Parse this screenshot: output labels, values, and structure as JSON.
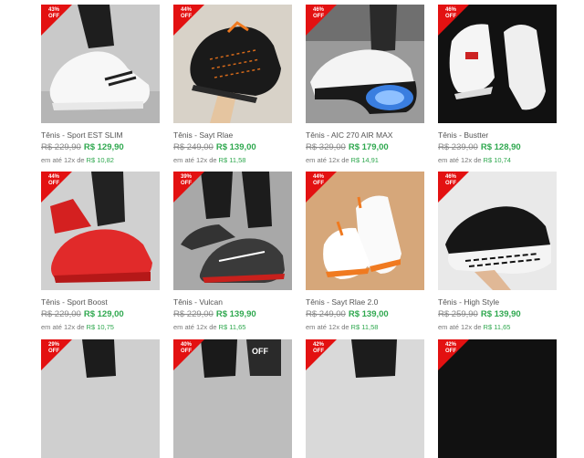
{
  "colors": {
    "badge": "#e31111",
    "price_green": "#2fa84f"
  },
  "products": [
    {
      "name": "Tênis - Sport EST SLIM",
      "discount": "43%",
      "off": "OFF",
      "old_price": "R$ 229,90",
      "new_price": "R$ 129,90",
      "installment": "em até 12x de",
      "installment_value": "R$ 10,82",
      "shoe_color": "white"
    },
    {
      "name": "Tênis - Sayt Rlae",
      "discount": "44%",
      "off": "OFF",
      "old_price": "R$ 249,00",
      "new_price": "R$ 139,00",
      "installment": "em até 12x de",
      "installment_value": "R$ 11,58",
      "shoe_color": "black-orange"
    },
    {
      "name": "Tênis - AIC 270 AIR MAX",
      "discount": "46%",
      "off": "OFF",
      "old_price": "R$ 329,00",
      "new_price": "R$ 179,00",
      "installment": "em até 12x de",
      "installment_value": "R$ 14,91",
      "shoe_color": "white-blue"
    },
    {
      "name": "Tênis - Bustter",
      "discount": "46%",
      "off": "OFF",
      "old_price": "R$ 239,00",
      "new_price": "R$ 128,90",
      "installment": "em até 12x de",
      "installment_value": "R$ 10,74",
      "shoe_color": "white"
    },
    {
      "name": "Tênis - Sport Boost",
      "discount": "44%",
      "off": "OFF",
      "old_price": "R$ 229,00",
      "new_price": "R$ 129,00",
      "installment": "em até 12x de",
      "installment_value": "R$ 10,75",
      "shoe_color": "red"
    },
    {
      "name": "Tênis - Vulcan",
      "discount": "39%",
      "off": "OFF",
      "old_price": "R$ 229,00",
      "new_price": "R$ 139,90",
      "installment": "em até 12x de",
      "installment_value": "R$ 11,65",
      "shoe_color": "gray-red"
    },
    {
      "name": "Tênis - Sayt Rlae 2.0",
      "discount": "44%",
      "off": "OFF",
      "old_price": "R$ 249,00",
      "new_price": "R$ 139,00",
      "installment": "em até 12x de",
      "installment_value": "R$ 11,58",
      "shoe_color": "white-orange"
    },
    {
      "name": "Tênis - High Style",
      "discount": "46%",
      "off": "OFF",
      "old_price": "R$ 259,90",
      "new_price": "R$ 139,90",
      "installment": "em até 12x de",
      "installment_value": "R$ 11,65",
      "shoe_color": "black-white"
    },
    {
      "discount": "29%",
      "off": "OFF",
      "shoe_color": "dark"
    },
    {
      "discount": "40%",
      "off": "OFF",
      "shoe_color": "dark-off"
    },
    {
      "discount": "42%",
      "off": "OFF",
      "shoe_color": "dark"
    },
    {
      "discount": "42%",
      "off": "OFF",
      "shoe_color": "black"
    }
  ]
}
